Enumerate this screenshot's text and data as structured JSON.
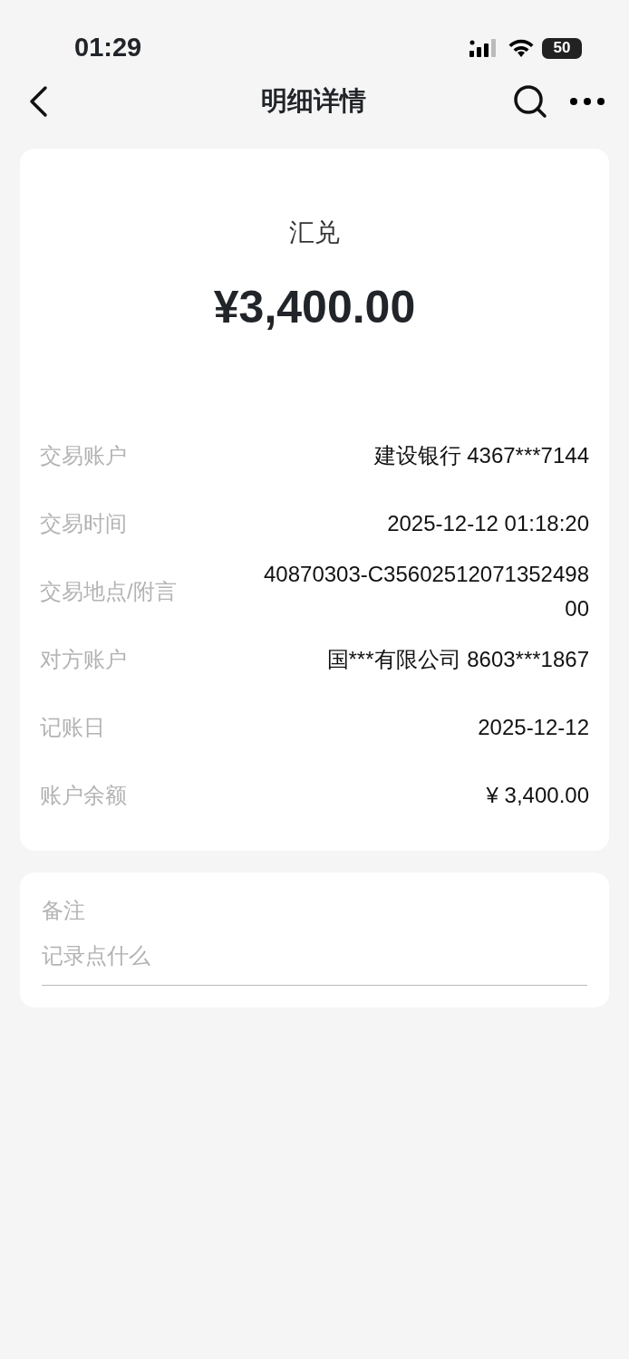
{
  "status_bar": {
    "time": "01:29",
    "battery": "50"
  },
  "nav": {
    "title": "明细详情"
  },
  "summary": {
    "type": "汇兑",
    "amount": "¥3,400.00"
  },
  "details": [
    {
      "label": "交易账户",
      "value": "建设银行 4367***7144"
    },
    {
      "label": "交易时间",
      "value": "2025-12-12 01:18:20"
    },
    {
      "label": "交易地点/附言",
      "value": "40870303-C3560251207135249800"
    },
    {
      "label": "对方账户",
      "value": "国***有限公司 8603***1867"
    },
    {
      "label": "记账日",
      "value": "2025-12-12"
    },
    {
      "label": "账户余额",
      "value": "¥ 3,400.00"
    }
  ],
  "note": {
    "label": "备注",
    "placeholder": "记录点什么"
  }
}
